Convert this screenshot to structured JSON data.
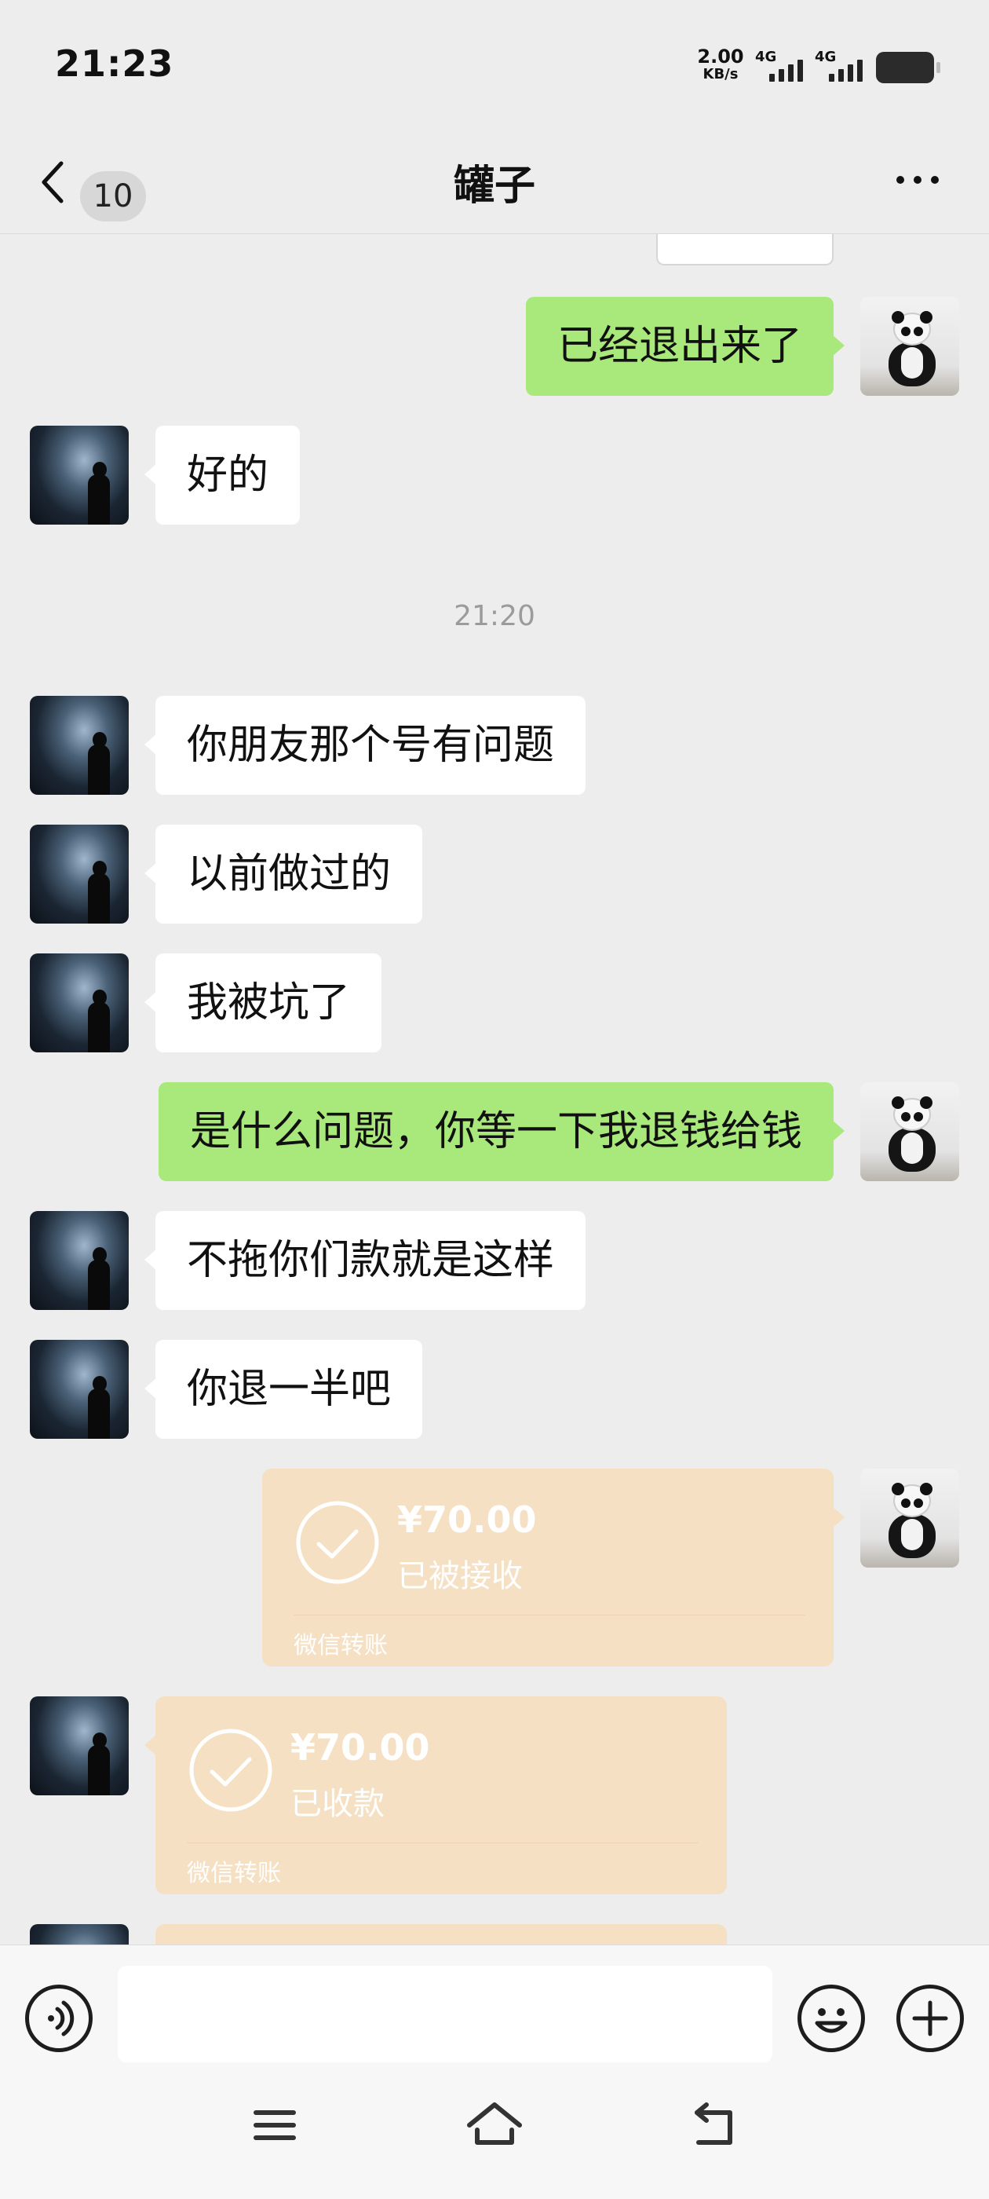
{
  "status_bar": {
    "time": "21:23",
    "net_speed_value": "2.00",
    "net_speed_unit": "KB/s",
    "sim1_label": "4G",
    "sim2_label": "4G"
  },
  "nav": {
    "unread_count": "10",
    "title": "罐子"
  },
  "messages": [
    {
      "side": "self",
      "text": "已经退出来了"
    },
    {
      "side": "friend",
      "text": "好的"
    },
    {
      "type": "timestamp",
      "text": "21:20"
    },
    {
      "side": "friend",
      "text": "你朋友那个号有问题"
    },
    {
      "side": "friend",
      "text": "以前做过的"
    },
    {
      "side": "friend",
      "text": "我被坑了"
    },
    {
      "side": "self",
      "text": "是什么问题，你等一下我退钱给钱"
    },
    {
      "side": "friend",
      "text": "不拖你们款就是这样"
    },
    {
      "side": "friend",
      "text": "你退一半吧"
    }
  ],
  "transfers": [
    {
      "side": "self",
      "amount": "¥70.00",
      "status": "已被接收",
      "label": "微信转账"
    },
    {
      "side": "friend",
      "amount": "¥70.00",
      "status": "已收款",
      "label": "微信转账"
    }
  ],
  "input": {
    "placeholder": "",
    "value": ""
  },
  "colors": {
    "background": "#ededed",
    "outgoing_bubble": "#a9e87a",
    "incoming_bubble": "#ffffff",
    "transfer_card": "#f6e0c4",
    "timestamp_text": "#9b9b9b"
  },
  "icons": [
    "back-icon",
    "more-icon",
    "voice-icon",
    "emoji-icon",
    "plus-icon",
    "menu-icon",
    "home-icon",
    "back-nav-icon"
  ]
}
